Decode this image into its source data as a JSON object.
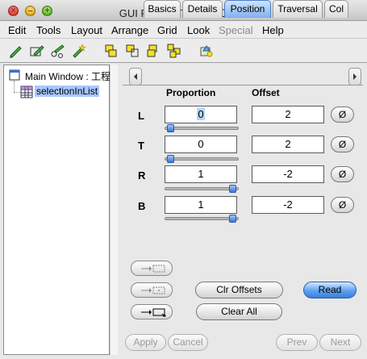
{
  "window": {
    "title": "GUI Painter Tool on: 工程表",
    "close_glyph": "×",
    "minimize_glyph": "–",
    "zoom_glyph": "+"
  },
  "menu": {
    "items": [
      "Edit",
      "Tools",
      "Layout",
      "Arrange",
      "Grid",
      "Look",
      "Special",
      "Help"
    ]
  },
  "toolbar": {
    "icons": [
      "pencil-icon",
      "pencil-box-icon",
      "pencil-nodes-icon",
      "pencil-spark-icon",
      "align-left-icon",
      "align-top-icon",
      "align-center-icon",
      "align-grid-icon",
      "inspector-icon"
    ]
  },
  "tree": {
    "items": [
      {
        "label": "Main Window : 工程",
        "icon": "window-icon"
      },
      {
        "label": "selectionInList",
        "icon": "table-icon",
        "selected": true
      }
    ]
  },
  "tabs": {
    "items": [
      "Basics",
      "Details",
      "Position",
      "Traversal",
      "Col"
    ],
    "active": "Position"
  },
  "position": {
    "proportion_header": "Proportion",
    "offset_header": "Offset",
    "rows": [
      {
        "label": "L",
        "proportion": "0",
        "offset": "2",
        "slider": 0
      },
      {
        "label": "T",
        "proportion": "0",
        "offset": "2",
        "slider": 0
      },
      {
        "label": "R",
        "proportion": "1",
        "offset": "-2",
        "slider": 1
      },
      {
        "label": "B",
        "proportion": "1",
        "offset": "-2",
        "slider": 1
      }
    ],
    "zero_label": "Ø"
  },
  "actions": {
    "clr_offsets": "Clr Offsets",
    "read": "Read",
    "clear_all": "Clear All"
  },
  "footer": {
    "apply": "Apply",
    "cancel": "Cancel",
    "prev": "Prev",
    "next": "Next"
  },
  "colors": {
    "accent": "#5fa0ee",
    "selection": "#a8c8ff"
  }
}
